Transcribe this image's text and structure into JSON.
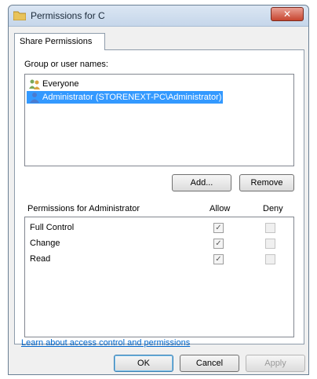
{
  "window": {
    "title": "Permissions for C",
    "close_glyph": "✕"
  },
  "tab": {
    "label": "Share Permissions"
  },
  "group": {
    "label": "Group or user names:",
    "users": [
      {
        "name": "Everyone",
        "icon": "group-icon",
        "selected": false
      },
      {
        "name": "Administrator (STORENEXT-PC\\Administrator)",
        "icon": "user-icon",
        "selected": true
      }
    ]
  },
  "buttons": {
    "add": "Add...",
    "remove": "Remove",
    "ok": "OK",
    "cancel": "Cancel",
    "apply": "Apply"
  },
  "permissions": {
    "label": "Permissions for Administrator",
    "allow_header": "Allow",
    "deny_header": "Deny",
    "rows": [
      {
        "name": "Full Control",
        "allow": true,
        "deny": false
      },
      {
        "name": "Change",
        "allow": true,
        "deny": false
      },
      {
        "name": "Read",
        "allow": true,
        "deny": false
      }
    ],
    "check_glyph": "✓"
  },
  "link": {
    "text": "Learn about access control and permissions"
  },
  "colors": {
    "selection": "#3399ff",
    "link": "#0066cc",
    "close": "#c7452f"
  }
}
